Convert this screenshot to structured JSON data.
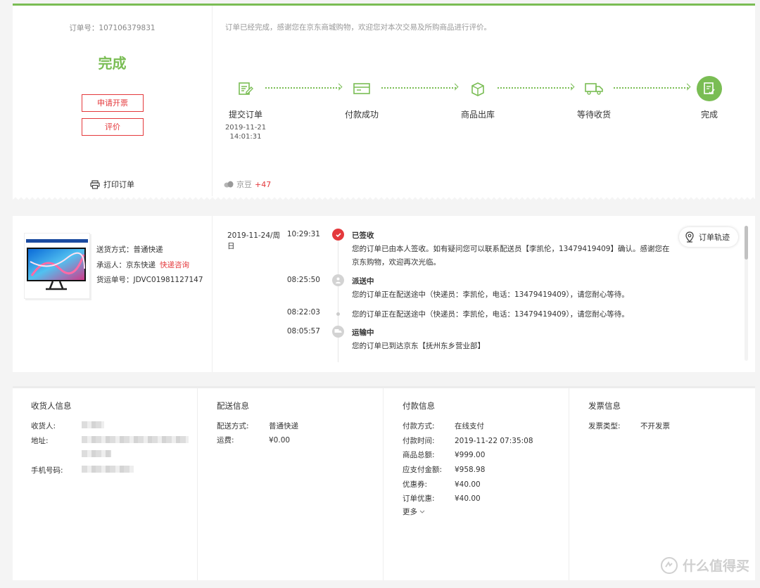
{
  "order": {
    "number_label": "订单号：",
    "number": "107106379831",
    "status": "完成",
    "invoice_button": "申请开票",
    "review_button": "评价",
    "print_label": "打印订单",
    "notice": "订单已经完成，感谢您在京东商城购物，欢迎您对本次交易及所购商品进行评价。",
    "beans_label": "京豆",
    "beans_value": "+47"
  },
  "steps": [
    {
      "label": "提交订单",
      "date": "2019-11-21",
      "time": "14:01:31",
      "icon": "edit-order-icon"
    },
    {
      "label": "付款成功",
      "icon": "payment-card-icon"
    },
    {
      "label": "商品出库",
      "icon": "package-icon"
    },
    {
      "label": "等待收货",
      "icon": "truck-icon"
    },
    {
      "label": "完成",
      "icon": "complete-icon"
    }
  ],
  "shipping": {
    "method_label": "送货方式：",
    "method": "普通快递",
    "carrier_label": "承运人：",
    "carrier": "京东快递",
    "consult_link": "快递咨询",
    "tracking_label": "货运单号：",
    "tracking_no": "JDVC01981127147",
    "route_button": "订单轨迹"
  },
  "tracking": [
    {
      "date": "2019-11-24/周日",
      "time": "10:29:31",
      "title": "已签收",
      "desc": "您的订单已由本人签收。如有疑问您可以联系配送员【李凯伦，13479419409】确认。感谢您在京东购物，欢迎再次光临。"
    },
    {
      "time": "08:25:50",
      "title": "派送中",
      "desc": "您的订单正在配送途中（快递员：李凯伦，电话：13479419409），请您耐心等待。"
    },
    {
      "time": "08:22:03",
      "desc": "您的订单正在配送途中（快递员：李凯伦，电话：13479419409），请您耐心等待。"
    },
    {
      "time": "08:05:57",
      "title": "运输中",
      "desc": "您的订单已到达京东【抚州东乡营业部】"
    }
  ],
  "consignee": {
    "heading": "收货人信息",
    "name_label": "收货人:",
    "address_label": "地址:",
    "phone_label": "手机号码:"
  },
  "delivery": {
    "heading": "配送信息",
    "method_label": "配送方式:",
    "method": "普通快递",
    "fee_label": "运费:",
    "fee": "¥0.00"
  },
  "payment": {
    "heading": "付款信息",
    "rows": [
      {
        "k": "付款方式:",
        "v": "在线支付"
      },
      {
        "k": "付款时间:",
        "v": "2019-11-22 07:35:08"
      },
      {
        "k": "商品总额:",
        "v": "¥999.00"
      },
      {
        "k": "应支付金额:",
        "v": "¥958.98"
      },
      {
        "k": "优惠券:",
        "v": "¥40.00"
      },
      {
        "k": "订单优惠:",
        "v": "¥40.00"
      }
    ],
    "more": "更多"
  },
  "invoice": {
    "heading": "发票信息",
    "type_label": "发票类型:",
    "type": "不开发票"
  },
  "watermark": "什么值得买",
  "colors": {
    "accent_green": "#7abd54",
    "accent_red": "#e4393c"
  }
}
